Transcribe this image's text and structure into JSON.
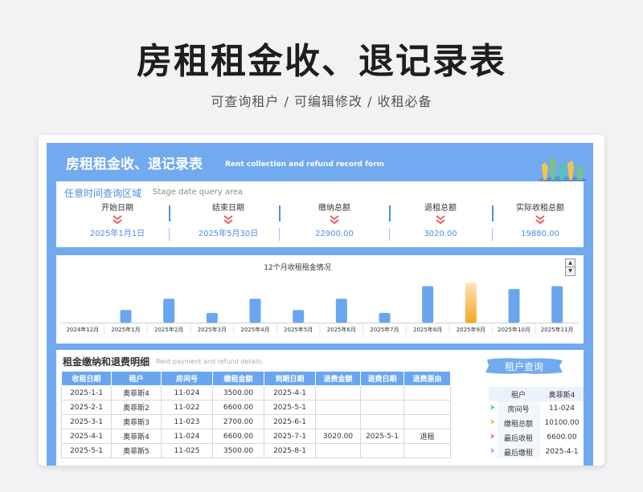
{
  "page": {
    "title": "房租租金收、退记录表",
    "subtitle": "可查询租户 /  可编辑修改  / 收租必备"
  },
  "banner": {
    "title": "房租租金收、退记录表",
    "subtitle": "Rent collection and refund record form"
  },
  "query": {
    "title": "任意时间查询区域",
    "subtitle": "Stage date query area",
    "metrics": [
      {
        "label": "开始日期",
        "value": "2025年1月1日"
      },
      {
        "label": "结束日期",
        "value": "2025年5月30日"
      },
      {
        "label": "缴纳总额",
        "value": "22900.00"
      },
      {
        "label": "退租总额",
        "value": "3020.00"
      },
      {
        "label": "实际收租总额",
        "value": "19880.00"
      }
    ]
  },
  "colors": {
    "accent": "#72aaf0",
    "bar": "#6aa6f0",
    "bar_highlight": "#f5a623",
    "chevron": "#e85a6a"
  },
  "chart_data": {
    "type": "bar",
    "title": "12个月收租租金情况",
    "categories": [
      "2024年12月",
      "2025年1月",
      "2025年2月",
      "2025年3月",
      "2025年4月",
      "2025年5月",
      "2025年6月",
      "2025年7月",
      "2025年8月",
      "2025年9月",
      "2025年10月",
      "2025年11月"
    ],
    "values": [
      0,
      3500,
      6600,
      2700,
      6600,
      3500,
      6600,
      2700,
      10100,
      11000,
      9300,
      10100
    ],
    "highlight_index": 9,
    "ylim": [
      0,
      12000
    ],
    "grid": false
  },
  "detail": {
    "title": "租金缴纳和退费明细",
    "subtitle": "Rent payment and refund details",
    "columns": [
      "收租日期",
      "租户",
      "房间号",
      "缴租金额",
      "到期日期",
      "退费金额",
      "退费日期",
      "退费原由"
    ],
    "rows": [
      [
        "2025-1-1",
        "奥菲斯4",
        "11-024",
        "3500.00",
        "2025-4-1",
        "",
        "",
        ""
      ],
      [
        "2025-2-1",
        "奥菲斯2",
        "11-022",
        "6600.00",
        "2025-5-1",
        "",
        "",
        ""
      ],
      [
        "2025-3-1",
        "奥菲斯3",
        "11-023",
        "2700.00",
        "2025-6-1",
        "",
        "",
        ""
      ],
      [
        "2025-4-1",
        "奥菲斯4",
        "11-024",
        "6600.00",
        "2025-7-1",
        "3020.00",
        "2025-5-1",
        "退租"
      ],
      [
        "2025-5-1",
        "奥菲斯5",
        "11-025",
        "3500.00",
        "2025-8-1",
        "",
        "",
        ""
      ]
    ]
  },
  "tenant": {
    "button": "租户查询",
    "header": [
      "租户",
      "奥菲斯4"
    ],
    "rows": [
      {
        "icon": "chevron-teal-icon",
        "color": "#1fb5a8",
        "label": "房间号",
        "value": "11-024"
      },
      {
        "icon": "chevron-orange-icon",
        "color": "#f5a623",
        "label": "缴租总额",
        "value": "10100.00"
      },
      {
        "icon": "chevron-red-icon",
        "color": "#e85a4f",
        "label": "最后收租",
        "value": "6600.00"
      },
      {
        "icon": "chevron-blue-icon",
        "color": "#6aa6f0",
        "label": "最后缴租",
        "value": "2025-4-1"
      }
    ]
  }
}
